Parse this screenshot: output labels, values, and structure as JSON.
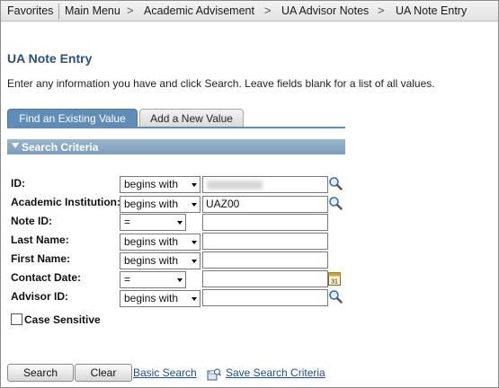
{
  "breadcrumb": {
    "favorites": "Favorites",
    "main_menu": "Main Menu",
    "items": [
      "Academic Advisement",
      "UA Advisor Notes",
      "UA Note Entry"
    ],
    "separator": ">"
  },
  "page": {
    "title": "UA Note Entry",
    "instructions": "Enter any information you have and click Search. Leave fields blank for a list of all values."
  },
  "tabs": {
    "active": "Find an Existing Value",
    "inactive": "Add a New Value"
  },
  "section": {
    "title": "Search Criteria"
  },
  "fields": {
    "id": {
      "label": "ID:",
      "operator": "begins with",
      "value": ""
    },
    "institution": {
      "label": "Academic Institution:",
      "operator": "begins with",
      "value": "UAZ00"
    },
    "note_id": {
      "label": "Note ID:",
      "operator": "=",
      "value": ""
    },
    "last_name": {
      "label": "Last Name:",
      "operator": "begins with",
      "value": ""
    },
    "first_name": {
      "label": "First Name:",
      "operator": "begins with",
      "value": ""
    },
    "contact_date": {
      "label": "Contact Date:",
      "operator": "=",
      "value": ""
    },
    "advisor_id": {
      "label": "Advisor ID:",
      "operator": "begins with",
      "value": ""
    }
  },
  "case_sensitive": {
    "label": "Case Sensitive",
    "checked": false
  },
  "buttons": {
    "search": "Search",
    "clear": "Clear",
    "basic_search": "Basic Search",
    "save_criteria": "Save Search Criteria"
  },
  "colors": {
    "title": "#2a4f79",
    "tab_active": "#5f8db7",
    "section_header": "#7c9dbd",
    "link": "#1f4e8c"
  }
}
